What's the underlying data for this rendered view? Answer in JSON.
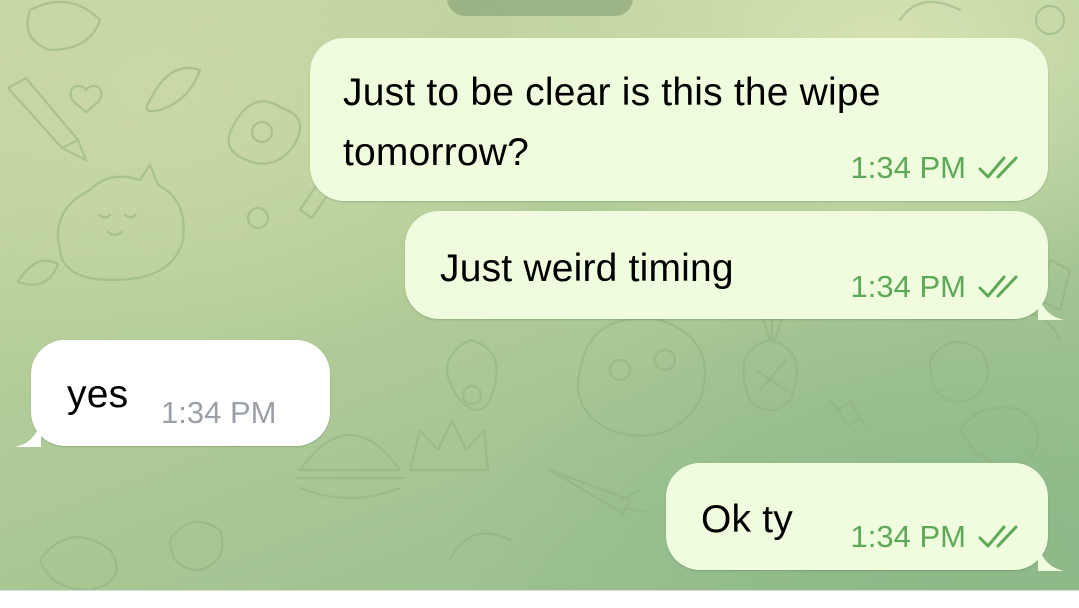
{
  "chat": {
    "messages": [
      {
        "direction": "outgoing",
        "lines": [
          "Just to be clear is this the wipe",
          "tomorrow?"
        ],
        "time": "1:34 PM",
        "status_icon": "double-check-icon"
      },
      {
        "direction": "outgoing",
        "lines": [
          "Just weird timing"
        ],
        "time": "1:34 PM",
        "status_icon": "double-check-icon"
      },
      {
        "direction": "incoming",
        "lines": [
          "yes"
        ],
        "time": "1:34 PM"
      },
      {
        "direction": "outgoing",
        "lines": [
          "Ok ty"
        ],
        "time": "1:34 PM",
        "status_icon": "double-check-icon"
      }
    ]
  },
  "colors": {
    "outgoing_bubble": "#effdde",
    "incoming_bubble": "#ffffff",
    "outgoing_meta": "#5ea957",
    "incoming_meta": "#9aa0a6",
    "wallpaper": "#b0cb97"
  }
}
